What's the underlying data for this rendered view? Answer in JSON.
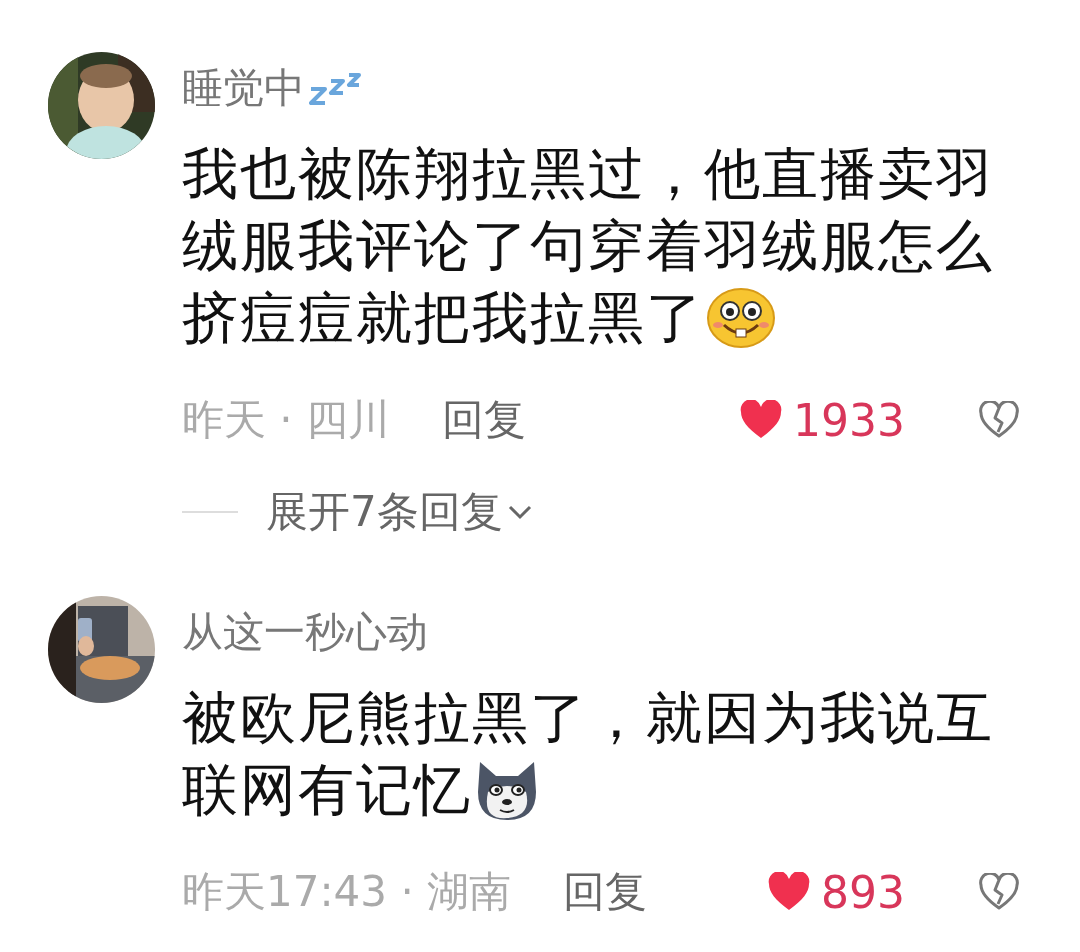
{
  "comments": [
    {
      "avatar": {
        "kind": "picture"
      },
      "name": "睡觉中",
      "badge": {
        "kind": "sleep"
      },
      "text_lines": [
        "我也被陈翔拉黑过，他直播卖羽",
        "绒服我评论了句穿着羽绒服怎么",
        "挤痘痘就把我拉黑了"
      ],
      "emoji": {
        "kind": "grin"
      },
      "meta": "昨天 · 四川",
      "reply": "回复",
      "likes": "1933",
      "expand": "展开7条回复"
    },
    {
      "avatar": {
        "kind": "picture"
      },
      "name": "从这一秒心动",
      "text_lines": [
        "被欧尼熊拉黑了，就因为我说互",
        "联网有记忆"
      ],
      "emoji": {
        "kind": "husky"
      },
      "meta": "昨天17:43 · 湖南",
      "reply": "回复",
      "likes": "893"
    }
  ]
}
